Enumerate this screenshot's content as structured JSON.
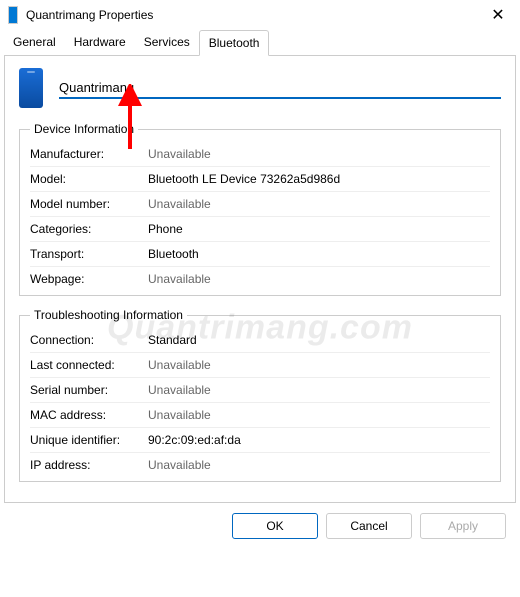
{
  "window": {
    "title": "Quantrimang Properties"
  },
  "tabs": {
    "general": "General",
    "hardware": "Hardware",
    "services": "Services",
    "bluetooth": "Bluetooth"
  },
  "device": {
    "name": "Quantrimang"
  },
  "deviceInfo": {
    "legend": "Device Information",
    "manufacturer": {
      "label": "Manufacturer:",
      "value": "Unavailable",
      "available": false
    },
    "model": {
      "label": "Model:",
      "value": "Bluetooth LE Device 73262a5d986d",
      "available": true
    },
    "modelNumber": {
      "label": "Model number:",
      "value": "Unavailable",
      "available": false
    },
    "categories": {
      "label": "Categories:",
      "value": "Phone",
      "available": true
    },
    "transport": {
      "label": "Transport:",
      "value": "Bluetooth",
      "available": true
    },
    "webpage": {
      "label": "Webpage:",
      "value": "Unavailable",
      "available": false
    }
  },
  "troubleshooting": {
    "legend": "Troubleshooting Information",
    "connection": {
      "label": "Connection:",
      "value": "Standard",
      "available": true
    },
    "lastConnected": {
      "label": "Last connected:",
      "value": "Unavailable",
      "available": false
    },
    "serialNumber": {
      "label": "Serial number:",
      "value": "Unavailable",
      "available": false
    },
    "macAddress": {
      "label": "MAC address:",
      "value": "Unavailable",
      "available": false
    },
    "uniqueId": {
      "label": "Unique identifier:",
      "value": "90:2c:09:ed:af:da",
      "available": true
    },
    "ipAddress": {
      "label": "IP address:",
      "value": "Unavailable",
      "available": false
    }
  },
  "buttons": {
    "ok": "OK",
    "cancel": "Cancel",
    "apply": "Apply"
  },
  "watermark": "Quantrimang.com"
}
